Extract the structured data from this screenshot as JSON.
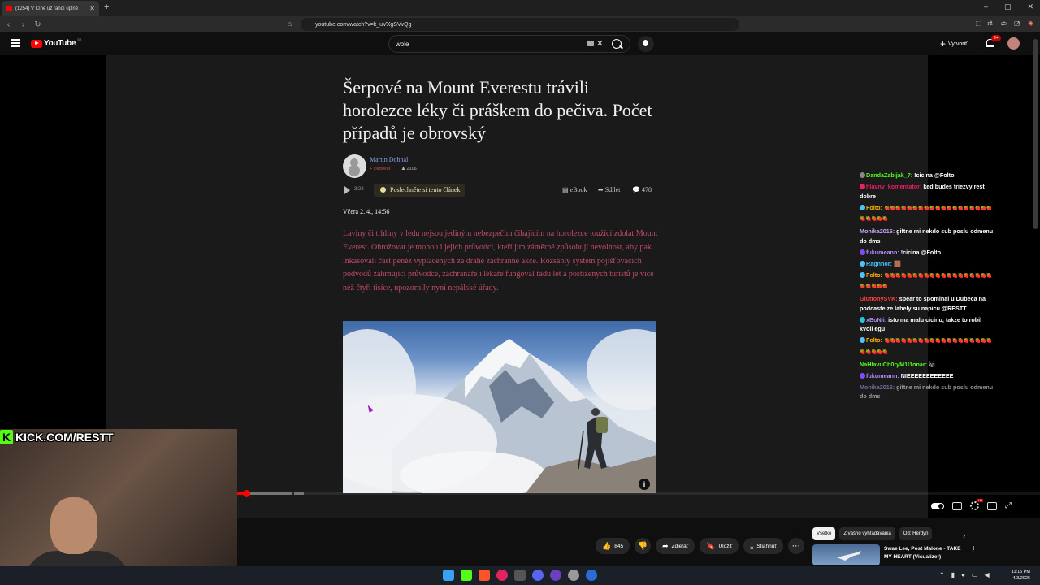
{
  "browser": {
    "tab_title": "(1254) V Číně už randí úplně",
    "url": "youtube.com/watch?v=k_uVXgSVvQg",
    "window_controls": [
      "–",
      "▢",
      "✕"
    ]
  },
  "youtube": {
    "logo_text": "YouTube",
    "country_code": "SK",
    "search_value": "wole",
    "create_label": "Vytvoriť",
    "notification_count": "9+"
  },
  "article": {
    "title": "Šerpové na Mount Everestu trávili horolezce léky či práškem do pečiva. Počet případů je obrovský",
    "author": "Martin Dohnal",
    "follow_label": "+ sledovat",
    "followers": "2106",
    "audio_duration": "3:28",
    "listen_label": "Poslechněte si tento článek",
    "ebook_label": "eBook",
    "share_label": "Sdílet",
    "comment_count": "478",
    "date": "Včera 2. 4., 14:56",
    "perex": "Laviny či trhliny v ledu nejsou jediným nebezpečím číhajícím na horolezce toužící zdolat Mount Everest. Ohrožovat je mohou i jejich průvodci, kteří jim záměrně způsobují nevolnost, aby pak inkasovali část peněz vyplacených za drahé záchranné akce. Rozsáhlý systém pojišťovacích podvodů zahrnující průvodce, záchranáře i lékaře fungoval řadu let a postižených turistů je více než čtyři tisíce, upozornily nyní nepálské úřady.",
    "photo_info": "i"
  },
  "webcam": {
    "overlay_text": "KICK.COM/RESTT"
  },
  "chat": [
    {
      "user": "DandaZabijak_7:",
      "user_color": "#53fc18",
      "text": "!cicina @Folto",
      "badge": "#888888"
    },
    {
      "user": "hlavny_komentator:",
      "user_color": "#e91e63",
      "text": "ked budes triezvy rest dobre",
      "badge": "#e91e63"
    },
    {
      "user": "Folto:",
      "user_color": "#ffb300",
      "text": "🍓🍓🍓🍓🍓🍓🍓🍓🍓🍓🍓🍓🍓🍓🍓🍓🍓🍓🍓🍓🍓🍓🍓🍓",
      "badge": "#4fc3f7"
    },
    {
      "user": "Monika2016:",
      "user_color": "#c6a8ff",
      "text": "giftne mi nekdo sub poslu odmenu do dms",
      "badge": ""
    },
    {
      "user": "fukumeann:",
      "user_color": "#b388ff",
      "text": "!cicina @Folto",
      "badge": "#7c4dff"
    },
    {
      "user": "Ragnnor:",
      "user_color": "#40c4ff",
      "text": "🟫",
      "badge": "#4fc3f7"
    },
    {
      "user": "Folto:",
      "user_color": "#ffb300",
      "text": "🍓🍓🍓🍓🍓🍓🍓🍓🍓🍓🍓🍓🍓🍓🍓🍓🍓🍓🍓🍓🍓🍓🍓🍓",
      "badge": "#4fc3f7"
    },
    {
      "user": "GluttonySVK:",
      "user_color": "#ff3d3d",
      "text": "spear to spominal u Dubeca na podcaste ze labely su napicu @RESTT",
      "badge": ""
    },
    {
      "user": "xBoNii:",
      "user_color": "#b388ff",
      "text": "isto ma malu cicinu, takze to robil kvoli egu",
      "badge": "#26c6da"
    },
    {
      "user": "Folto:",
      "user_color": "#ffb300",
      "text": "🍓🍓🍓🍓🍓🍓🍓🍓🍓🍓🍓🍓🍓🍓🍓🍓🍓🍓🍓🍓🍓🍓🍓🍓",
      "badge": "#4fc3f7"
    },
    {
      "user": "NaHlavuCh0ryM1l1onar:",
      "user_color": "#53fc18",
      "text": "🐱",
      "badge": ""
    },
    {
      "user": "fukumeann:",
      "user_color": "#b388ff",
      "text": "NIEEEEEEEEEEEE",
      "badge": "#7c4dff"
    },
    {
      "user": "Monika2016:",
      "user_color": "#c6a8ff",
      "text": "giftne mi nekdo sub poslu odmenu do dms",
      "badge": "",
      "faded": true
    }
  ],
  "actions": {
    "likes": "845",
    "share": "Zdieľať",
    "save": "Uložiť",
    "download": "Stiahnuť"
  },
  "chips": [
    "Všetko",
    "Z vášho vyhľadávania",
    "Od: Herdyn"
  ],
  "related": {
    "title": "Swae Lee, Post Malone - TAKE MY HEART (Visualizer)"
  },
  "taskbar": {
    "time": "11:15 PM",
    "date": "4/3/2026"
  },
  "colors": {
    "youtube_red": "#ff0000",
    "kick_green": "#53fc18",
    "perex_color": "#c24b66",
    "author_link": "#7ea6e0"
  }
}
